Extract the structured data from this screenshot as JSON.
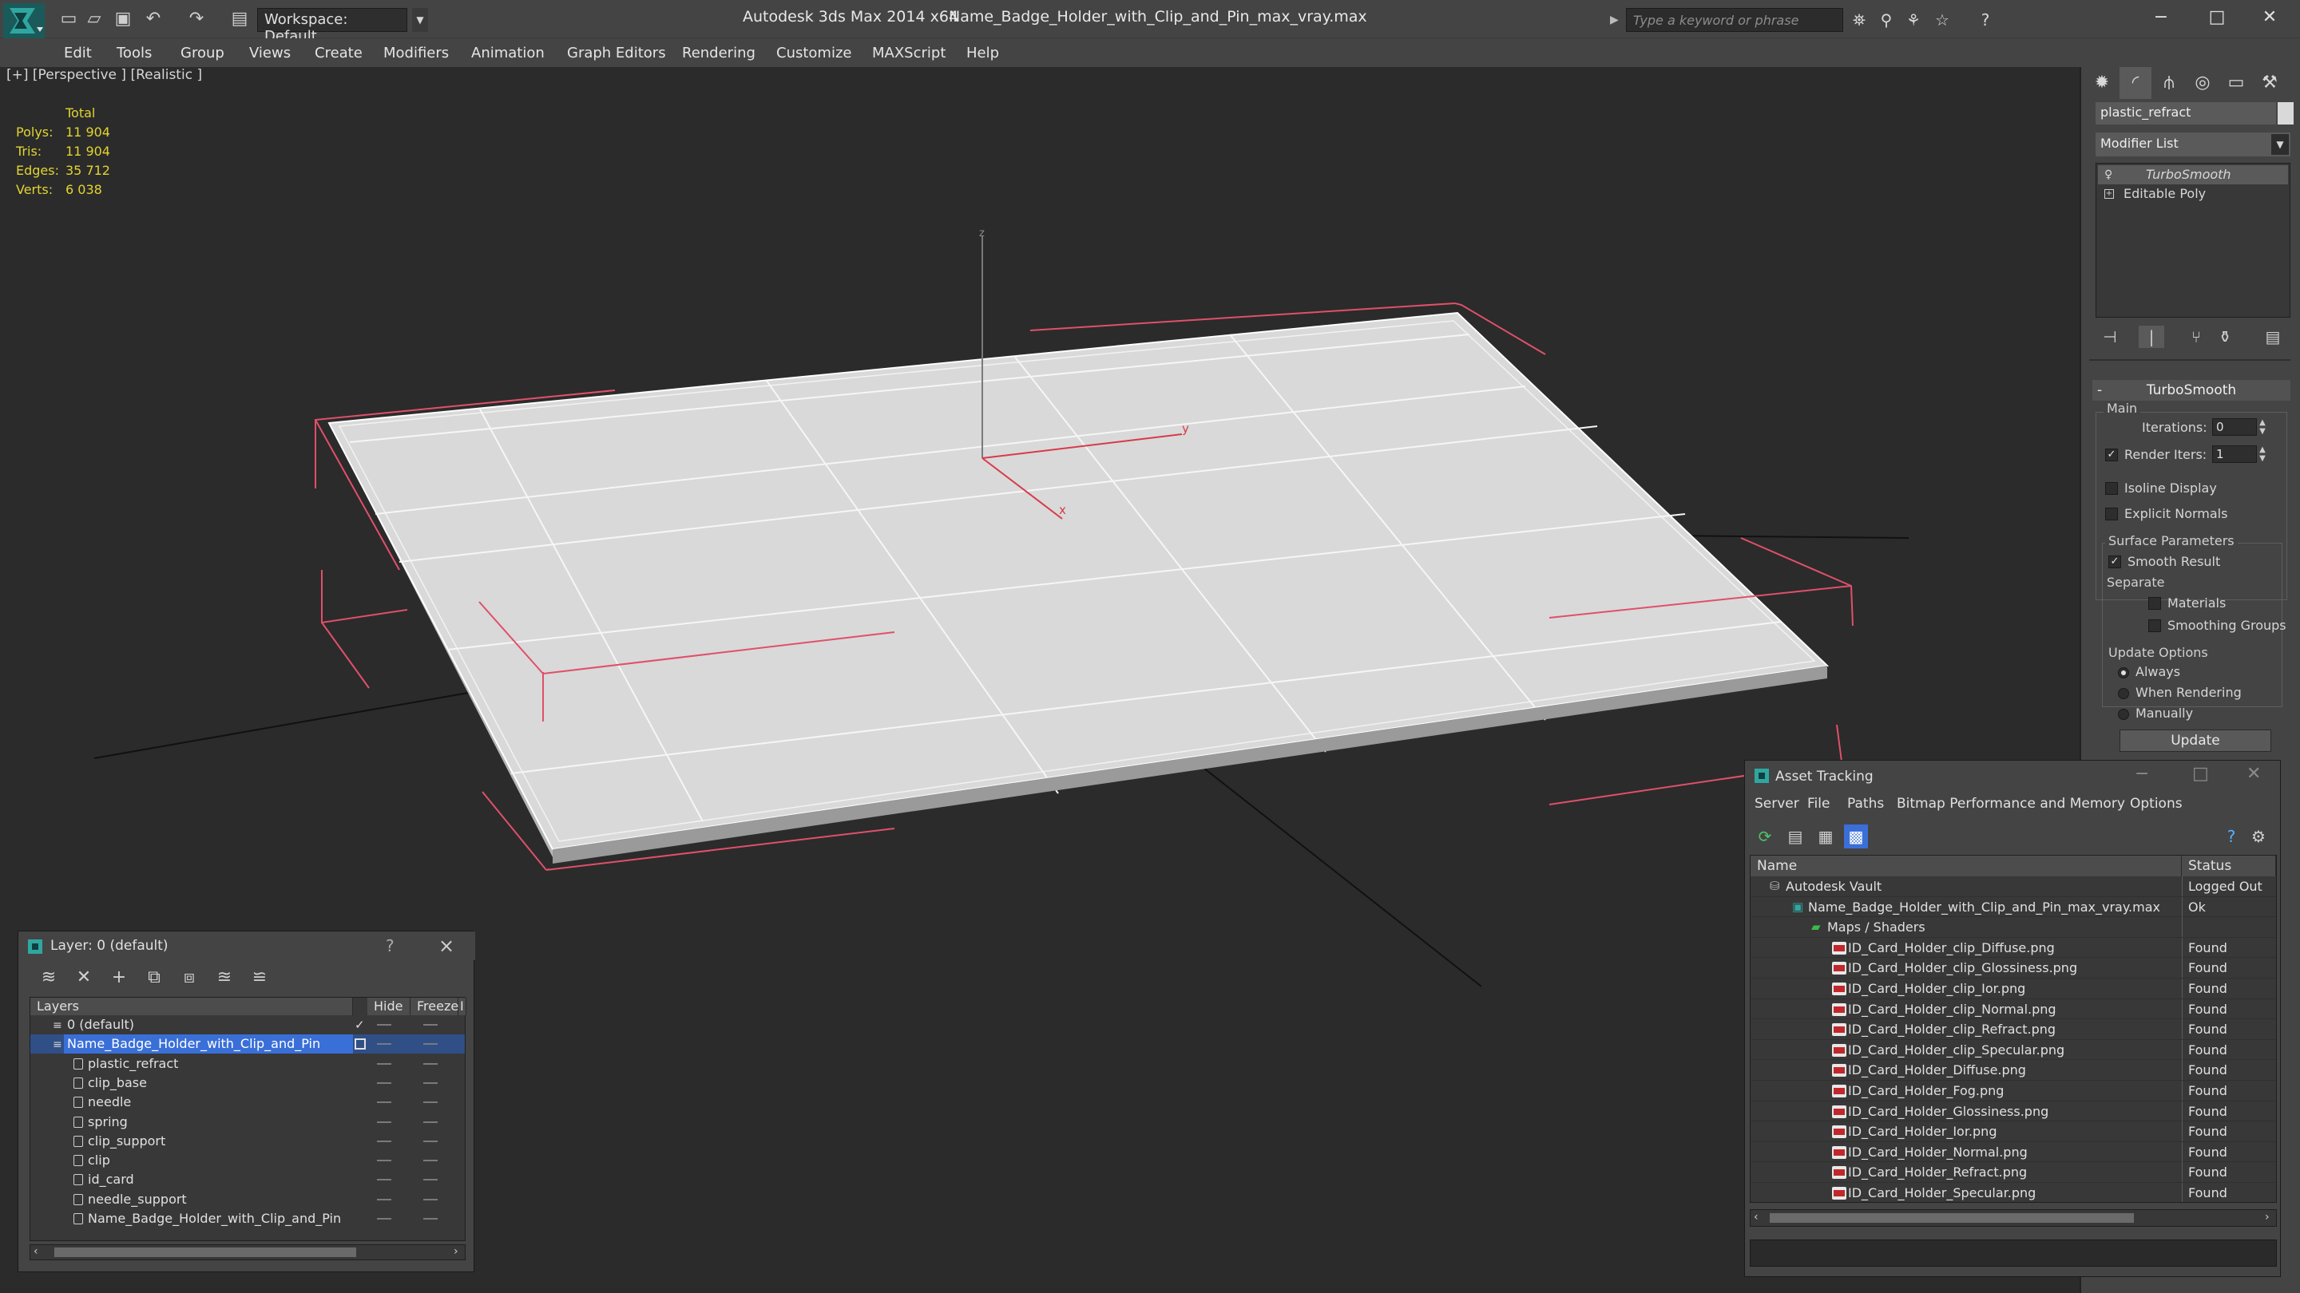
{
  "titlebar": {
    "app_title": "Autodesk 3ds Max  2014 x64",
    "doc_title": "Name_Badge_Holder_with_Clip_and_Pin_max_vray.max",
    "workspace_label": "Workspace: Default",
    "search_placeholder": "Type a keyword or phrase"
  },
  "menu": [
    "Edit",
    "Tools",
    "Group",
    "Views",
    "Create",
    "Modifiers",
    "Animation",
    "Graph Editors",
    "Rendering",
    "Customize",
    "MAXScript",
    "Help"
  ],
  "viewport": {
    "label": "[+] [Perspective ] [Realistic ]",
    "stats_header": "Total",
    "stats": [
      {
        "label": "Polys:",
        "value": "11 904"
      },
      {
        "label": "Tris:",
        "value": "11 904"
      },
      {
        "label": "Edges:",
        "value": "35 712"
      },
      {
        "label": "Verts:",
        "value": "6 038"
      }
    ],
    "axes": {
      "x": "x",
      "y": "y",
      "z": "z"
    }
  },
  "command_panel": {
    "object_name": "plastic_refract",
    "modifier_list": "Modifier List",
    "stack": [
      "TurboSmooth",
      "Editable Poly"
    ],
    "rollout_title": "TurboSmooth",
    "main_group": "Main",
    "iterations_label": "Iterations:",
    "iterations_value": "0",
    "render_iters_label": "Render Iters:",
    "render_iters_value": "1",
    "isoline_display": "Isoline Display",
    "explicit_normals": "Explicit Normals",
    "surface_params": "Surface Parameters",
    "smooth_result": "Smooth Result",
    "separate": "Separate",
    "materials": "Materials",
    "smoothing_groups": "Smoothing Groups",
    "update_options": "Update Options",
    "always": "Always",
    "when_rendering": "When Rendering",
    "manually": "Manually",
    "update_button": "Update"
  },
  "layer_dialog": {
    "title": "Layer: 0 (default)",
    "help": "?",
    "columns": [
      "Layers",
      "Hide",
      "Freeze",
      "I"
    ],
    "layers": [
      {
        "name": "0 (default)",
        "level": 0,
        "type": "layer"
      },
      {
        "name": "Name_Badge_Holder_with_Clip_and_Pin",
        "level": 0,
        "type": "layer",
        "selected": true
      },
      {
        "name": "plastic_refract",
        "level": 1,
        "type": "object"
      },
      {
        "name": "clip_base",
        "level": 1,
        "type": "object"
      },
      {
        "name": "needle",
        "level": 1,
        "type": "object"
      },
      {
        "name": "spring",
        "level": 1,
        "type": "object"
      },
      {
        "name": "clip_support",
        "level": 1,
        "type": "object"
      },
      {
        "name": "clip",
        "level": 1,
        "type": "object"
      },
      {
        "name": "id_card",
        "level": 1,
        "type": "object"
      },
      {
        "name": "needle_support",
        "level": 1,
        "type": "object"
      },
      {
        "name": "Name_Badge_Holder_with_Clip_and_Pin",
        "level": 1,
        "type": "object"
      }
    ]
  },
  "asset_dialog": {
    "title": "Asset Tracking",
    "menu": [
      "Server",
      "File",
      "Paths",
      "Bitmap Performance and Memory",
      "Options"
    ],
    "columns": [
      "Name",
      "Status"
    ],
    "rows": [
      {
        "name": "Autodesk Vault",
        "status": "Logged Out",
        "level": 0,
        "icon": "vault"
      },
      {
        "name": "Name_Badge_Holder_with_Clip_and_Pin_max_vray.max",
        "status": "Ok",
        "level": 1,
        "icon": "max"
      },
      {
        "name": "Maps / Shaders",
        "status": "",
        "level": 2,
        "icon": "folder"
      },
      {
        "name": "ID_Card_Holder_clip_Diffuse.png",
        "status": "Found",
        "level": 3,
        "icon": "png"
      },
      {
        "name": "ID_Card_Holder_clip_Glossiness.png",
        "status": "Found",
        "level": 3,
        "icon": "png"
      },
      {
        "name": "ID_Card_Holder_clip_Ior.png",
        "status": "Found",
        "level": 3,
        "icon": "png"
      },
      {
        "name": "ID_Card_Holder_clip_Normal.png",
        "status": "Found",
        "level": 3,
        "icon": "png"
      },
      {
        "name": "ID_Card_Holder_clip_Refract.png",
        "status": "Found",
        "level": 3,
        "icon": "png"
      },
      {
        "name": "ID_Card_Holder_clip_Specular.png",
        "status": "Found",
        "level": 3,
        "icon": "png"
      },
      {
        "name": "ID_Card_Holder_Diffuse.png",
        "status": "Found",
        "level": 3,
        "icon": "png"
      },
      {
        "name": "ID_Card_Holder_Fog.png",
        "status": "Found",
        "level": 3,
        "icon": "png"
      },
      {
        "name": "ID_Card_Holder_Glossiness.png",
        "status": "Found",
        "level": 3,
        "icon": "png"
      },
      {
        "name": "ID_Card_Holder_Ior.png",
        "status": "Found",
        "level": 3,
        "icon": "png"
      },
      {
        "name": "ID_Card_Holder_Normal.png",
        "status": "Found",
        "level": 3,
        "icon": "png"
      },
      {
        "name": "ID_Card_Holder_Refract.png",
        "status": "Found",
        "level": 3,
        "icon": "png"
      },
      {
        "name": "ID_Card_Holder_Specular.png",
        "status": "Found",
        "level": 3,
        "icon": "png"
      }
    ]
  },
  "colors": {
    "background": "#2b2b2b",
    "chrome": "#444444",
    "stats_text": "#e2d430",
    "selection": "#3a6fd8",
    "bbox_red": "#e0506a",
    "model_fill": "#d9d9d9"
  }
}
